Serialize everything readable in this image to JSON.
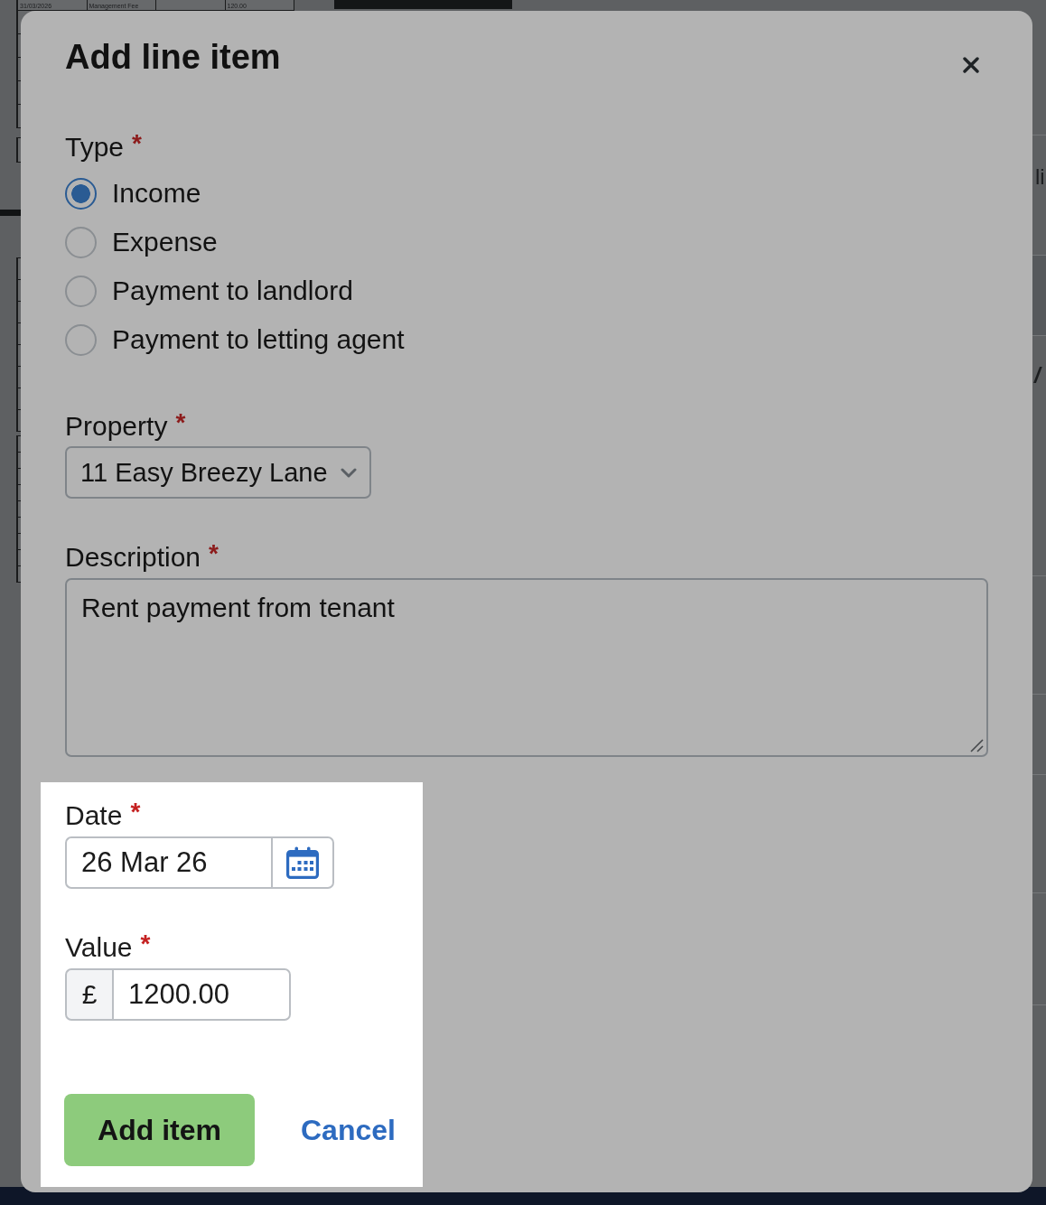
{
  "background": {
    "table_row": {
      "column_1": "31/03/2026",
      "column_2": "Management Fee",
      "column_4": "120.00"
    },
    "side_texts": [
      "li",
      "/"
    ]
  },
  "dialog": {
    "title": "Add line item",
    "type_field": {
      "label": "Type",
      "required_mark": "*",
      "options": [
        {
          "label": "Income",
          "selected": true
        },
        {
          "label": "Expense",
          "selected": false
        },
        {
          "label": "Payment to landlord",
          "selected": false
        },
        {
          "label": "Payment to letting agent",
          "selected": false
        }
      ]
    },
    "property_field": {
      "label": "Property",
      "required_mark": "*",
      "value": "11 Easy Breezy Lane"
    },
    "description_field": {
      "label": "Description",
      "required_mark": "*",
      "value": "Rent payment from tenant"
    },
    "highlighted_section": {
      "date_field": {
        "label": "Date",
        "required_mark": "*",
        "value": "26 Mar 26"
      },
      "value_field": {
        "label": "Value",
        "required_mark": "*",
        "prefix": "£",
        "value": "1200.00"
      },
      "buttons": [
        {
          "label": "Add item",
          "kind": "primary"
        },
        {
          "label": "Cancel",
          "kind": "link"
        }
      ]
    }
  }
}
